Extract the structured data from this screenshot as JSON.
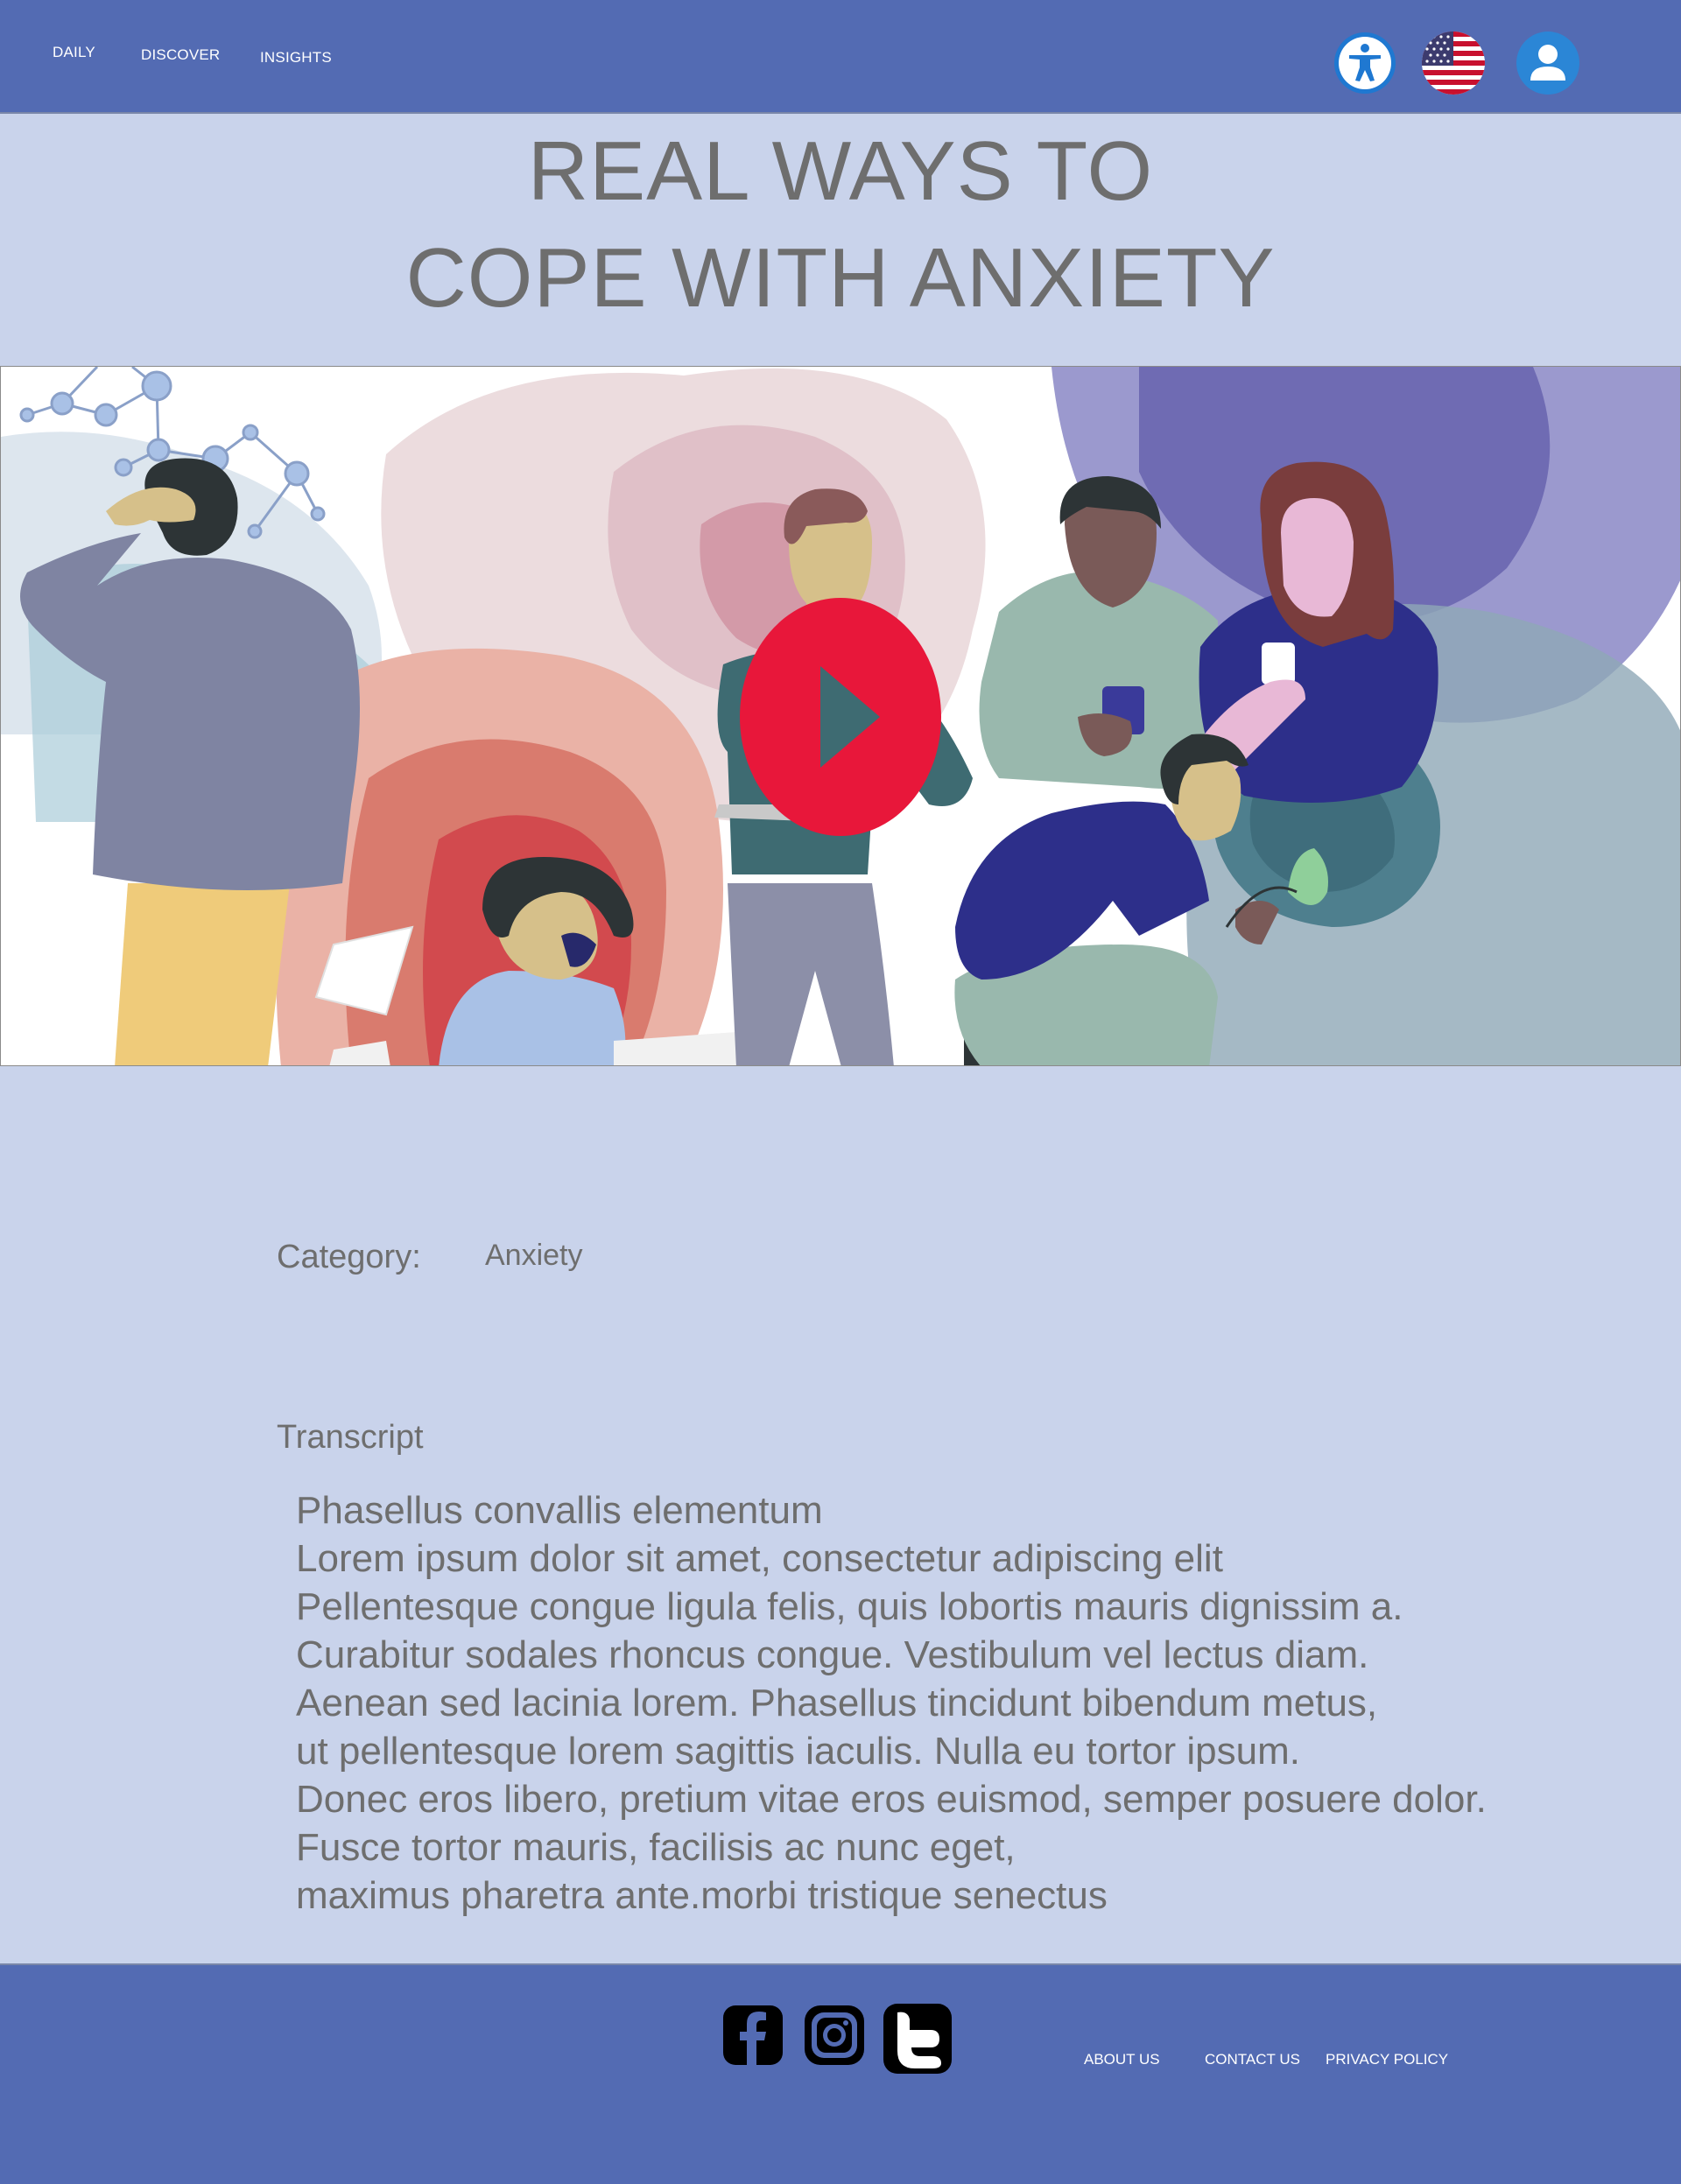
{
  "nav": {
    "items": [
      {
        "label": "DAILY"
      },
      {
        "label": "DISCOVER"
      },
      {
        "label": "INSIGHTS"
      }
    ]
  },
  "header_icons": [
    "accessibility-icon",
    "us-flag-icon",
    "user-profile-icon"
  ],
  "article": {
    "title_lines": [
      "REAL WAYS TO",
      "COPE WITH ANXIETY"
    ],
    "category_label": "Category:",
    "category_value": "Anxiety",
    "transcript_heading": "Transcript",
    "transcript_lines": [
      "Phasellus convallis elementum",
      "Lorem ipsum dolor sit amet, consectetur adipiscing elit",
      "Pellentesque congue ligula felis, quis lobortis mauris dignissim a.",
      "Curabitur sodales rhoncus congue. Vestibulum vel lectus diam.",
      "Aenean sed lacinia lorem. Phasellus tincidunt bibendum metus,",
      "ut pellentesque lorem sagittis iaculis. Nulla eu tortor ipsum.",
      "Donec eros libero, pretium vitae eros euismod, semper posuere dolor.",
      "Fusce tortor mauris, facilisis ac nunc eget,",
      "maximus pharetra ante.morbi tristique senectus"
    ]
  },
  "video": {
    "play_icon": "play-icon"
  },
  "footer": {
    "social_icons": [
      "facebook-icon",
      "instagram-icon",
      "twitter-icon"
    ],
    "links": [
      {
        "label": "ABOUT US"
      },
      {
        "label": "CONTACT US"
      },
      {
        "label": "PRIVACY POLICY"
      }
    ]
  },
  "colors": {
    "header_bg": "#536bb3",
    "page_bg": "#c9d3eb",
    "text_gray": "#6e6e6e",
    "play_red": "#e8173a"
  }
}
